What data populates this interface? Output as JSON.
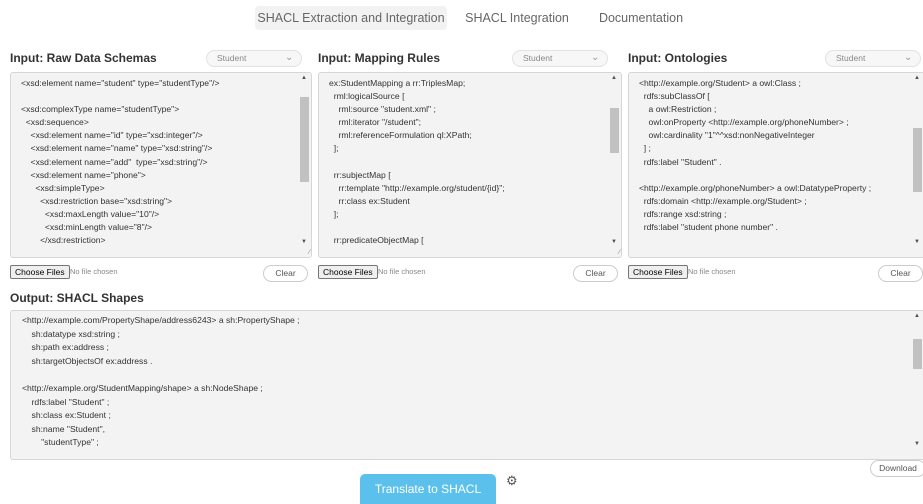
{
  "nav": {
    "tabs": [
      {
        "label": "SHACL Extraction and Integration",
        "active": true
      },
      {
        "label": "SHACL Integration",
        "active": false
      },
      {
        "label": "Documentation",
        "active": false
      }
    ]
  },
  "panels": {
    "raw_schemas": {
      "title": "Input: Raw Data Schemas",
      "select_value": "Student",
      "content": "<xsd:element name=\"student\" type=\"studentType\"/>\n\n<xsd:complexType name=\"studentType\">\n  <xsd:sequence>\n    <xsd:element name=\"id\" type=\"xsd:integer\"/>\n    <xsd:element name=\"name\" type=\"xsd:string\"/>\n    <xsd:element name=\"add\"  type=\"xsd:string\"/>\n    <xsd:element name=\"phone\">\n      <xsd:simpleType>\n        <xsd:restriction base=\"xsd:string\">\n          <xsd:maxLength value=\"10\"/>\n          <xsd:minLength value=\"8\"/>\n        </xsd:restriction>",
      "choose_files_label": "Choose Files",
      "no_file_text": "No file chosen",
      "clear_label": "Clear"
    },
    "mapping_rules": {
      "title": "Input: Mapping Rules",
      "select_value": "Student",
      "content": "ex:StudentMapping a rr:TriplesMap;\n  rml:logicalSource [\n    rml:source \"student.xml\" ;\n    rml:iterator \"/student\";\n    rml:referenceFormulation ql:XPath;\n  ];\n\n  rr:subjectMap [\n    rr:template \"http://example.org/student/{id}\";\n    rr:class ex:Student\n  ];\n\n  rr:predicateObjectMap [",
      "choose_files_label": "Choose Files",
      "no_file_text": "No file chosen",
      "clear_label": "Clear"
    },
    "ontologies": {
      "title": "Input: Ontologies",
      "select_value": "Student",
      "content": "<http://example.org/Student> a owl:Class ;\n  rdfs:subClassOf [\n    a owl:Restriction ;\n    owl:onProperty <http://example.org/phoneNumber> ;\n    owl:cardinality \"1\"^^xsd:nonNegativeInteger\n  ] ;\n  rdfs:label \"Student\" .\n\n<http://example.org/phoneNumber> a owl:DatatypeProperty ;\n  rdfs:domain <http://example.org/Student> ;\n  rdfs:range xsd:string ;\n  rdfs:label \"student phone number\" .",
      "choose_files_label": "Choose Files",
      "no_file_text": "No file chosen",
      "clear_label": "Clear"
    }
  },
  "output": {
    "title": "Output: SHACL Shapes",
    "content": "<http://example.com/PropertyShape/address6243> a sh:PropertyShape ;\n    sh:datatype xsd:string ;\n    sh:path ex:address ;\n    sh:targetObjectsOf ex:address .\n\n<http://example.org/StudentMapping/shape> a sh:NodeShape ;\n    rdfs:label \"Student\" ;\n    sh:class ex:Student ;\n    sh:name \"Student\",\n        \"studentType\" ;",
    "download_label": "Download"
  },
  "actions": {
    "translate_label": "Translate to SHACL",
    "settings_icon": "gear-icon"
  },
  "colors": {
    "accent": "#5bc0eb",
    "textarea_bg": "#f3f3f3",
    "active_tab_bg": "#f2f2f2"
  }
}
